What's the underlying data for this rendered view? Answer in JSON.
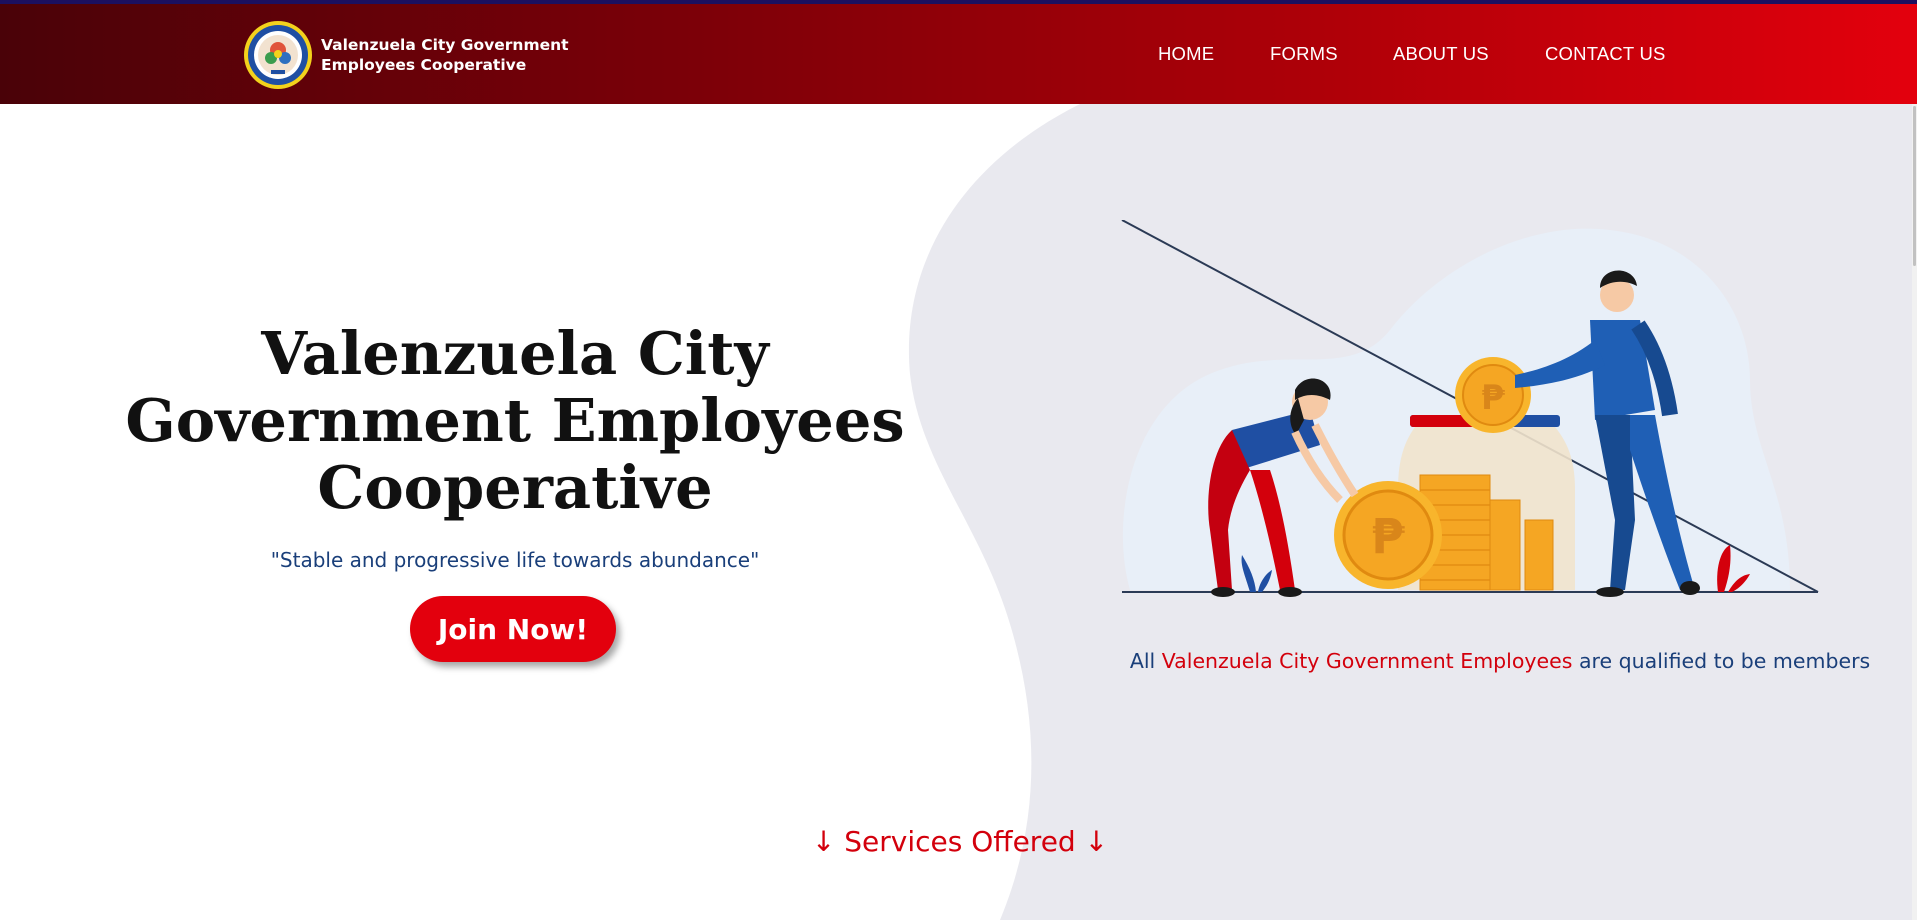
{
  "brand": {
    "line1": "Valenzuela City Government",
    "line2": "Employees Cooperative",
    "logo_icon": "cooperative-seal-logo"
  },
  "nav": {
    "items": [
      {
        "label": "HOME"
      },
      {
        "label": "FORMS"
      },
      {
        "label": "ABOUT US"
      },
      {
        "label": "CONTACT US"
      }
    ]
  },
  "hero": {
    "title_lines": [
      "Valenzuela City",
      "Government Employees",
      "Cooperative"
    ],
    "tagline": "\"Stable and progressive life towards abundance\"",
    "cta": "Join Now!",
    "illustration": "people-saving-peso-coins-illustration"
  },
  "members": {
    "prefix": "All ",
    "highlight": "Valenzuela City Government Employees",
    "suffix": " are qualified to be members"
  },
  "services": {
    "label": "↓ Services Offered ↓"
  },
  "colors": {
    "nav_gradient_start": "#4a0208",
    "nav_gradient_end": "#e3000d",
    "accent_red": "#e3000d",
    "text_blue": "#1a3f7a",
    "hero_blob": "#e9e9ef"
  }
}
